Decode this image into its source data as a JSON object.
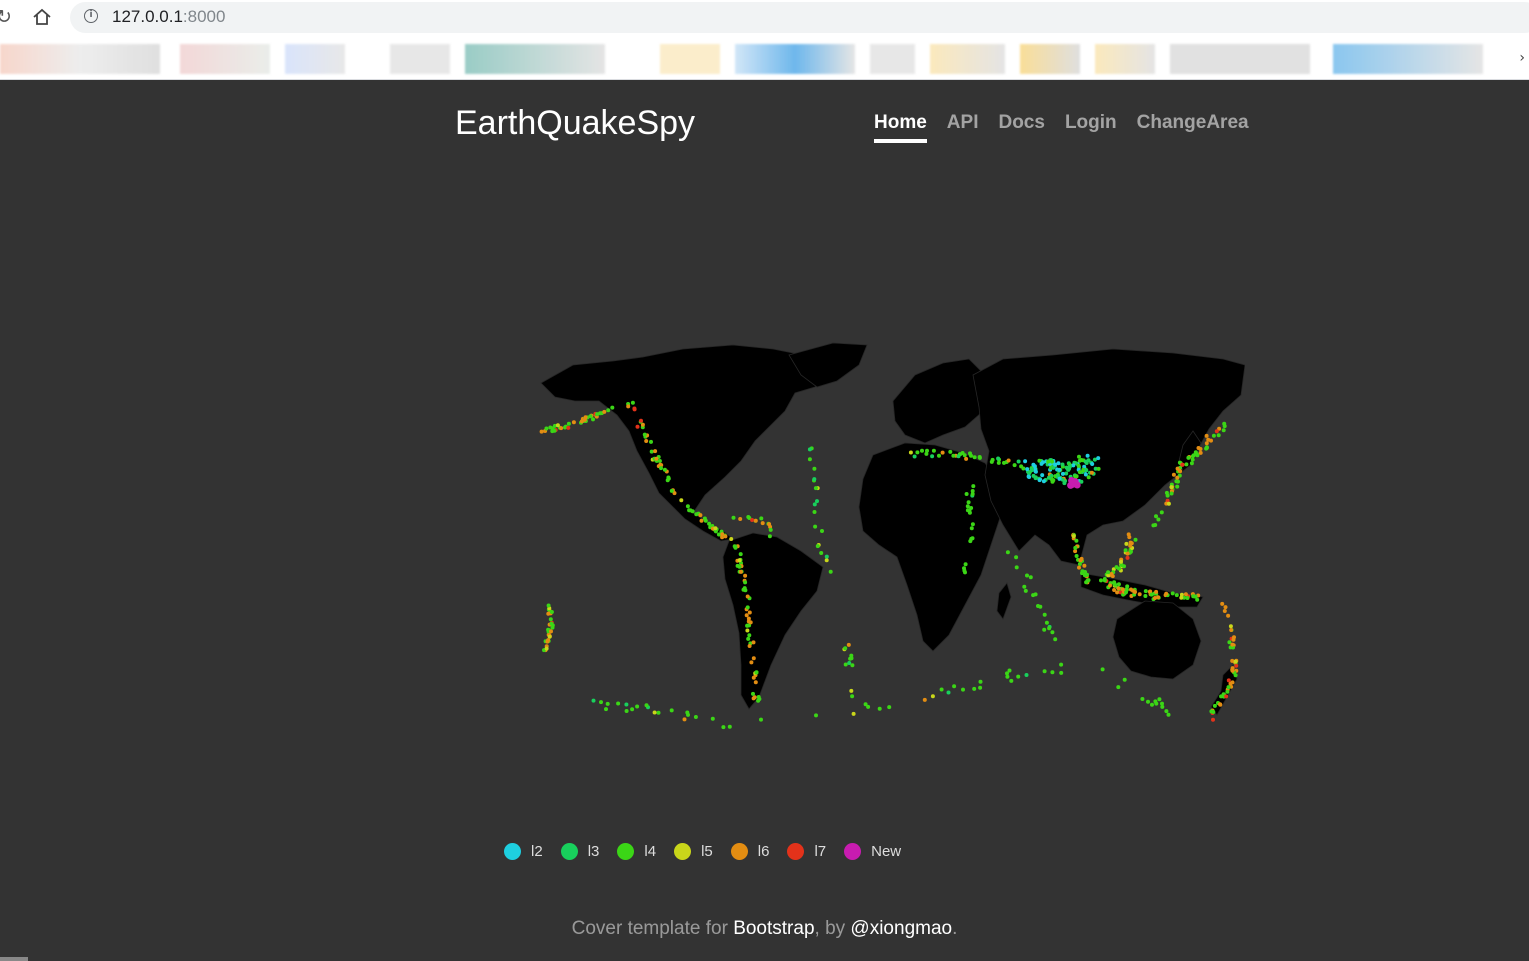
{
  "browser": {
    "url_host": "127.0.0.1",
    "url_port": ":8000"
  },
  "header": {
    "brand": "EarthQuakeSpy",
    "nav": [
      {
        "label": "Home",
        "active": true
      },
      {
        "label": "API",
        "active": false
      },
      {
        "label": "Docs",
        "active": false
      },
      {
        "label": "Login",
        "active": false
      },
      {
        "label": "ChangeArea",
        "active": false
      }
    ]
  },
  "legend": [
    {
      "label": "l2",
      "color": "#1ecfe0"
    },
    {
      "label": "l3",
      "color": "#18d05c"
    },
    {
      "label": "l4",
      "color": "#3bd616"
    },
    {
      "label": "l5",
      "color": "#c9d61a"
    },
    {
      "label": "l6",
      "color": "#e38d12"
    },
    {
      "label": "l7",
      "color": "#e3321a"
    },
    {
      "label": "New",
      "color": "#c81cb0"
    }
  ],
  "footer": {
    "prefix": "Cover template for ",
    "bootstrap": "Bootstrap",
    "middle": ", by ",
    "author": "@xiongmao",
    "suffix": "."
  },
  "colors": {
    "page_bg": "#333333",
    "land": "#000000",
    "borders": "#2a2a2a"
  }
}
